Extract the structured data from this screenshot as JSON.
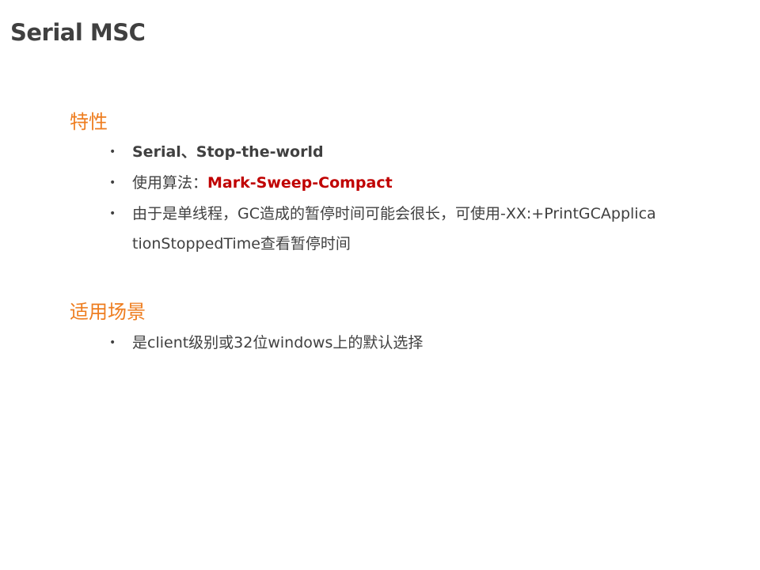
{
  "slide": {
    "title": "Serial MSC",
    "sections": [
      {
        "heading": "特性",
        "bullets": [
          {
            "text": "Serial、Stop-the-world"
          },
          {
            "prefix": "使用算法：",
            "highlight": "Mark-Sweep-Compact"
          },
          {
            "line1": "由于是单线程，GC造成的暂停时间可能会很长，可使用-XX:+PrintGCApplica",
            "line2": "tionStoppedTime查看暂停时间"
          }
        ]
      },
      {
        "heading": "适用场景",
        "bullets": [
          {
            "text": "是client级别或32位windows上的默认选择"
          }
        ]
      }
    ],
    "bullet_symbol": "•",
    "colors": {
      "title": "#404040",
      "heading": "#ee7d1f",
      "body": "#404040",
      "highlight": "#c00000"
    }
  }
}
